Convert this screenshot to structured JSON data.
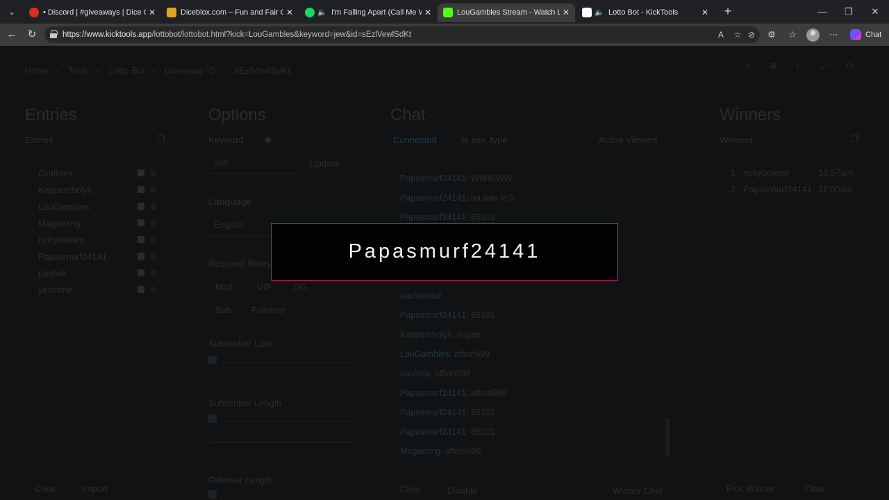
{
  "browser": {
    "tabs": [
      {
        "title": "• Discord | #giveaways | Dice Com",
        "favicon_color": "#d93025",
        "audio": false,
        "active": false
      },
      {
        "title": "Diceblox.com – Fun and Fair Game",
        "favicon_color": "#e0a526",
        "audio": false,
        "active": false
      },
      {
        "title": "I'm Falling Apart (Call Me Whe",
        "favicon_color": "#1ed760",
        "audio": true,
        "active": false
      },
      {
        "title": "LouGambles Stream - Watch Live c",
        "favicon_color": "#53fc18",
        "audio": false,
        "active": true
      },
      {
        "title": "Lotto Bot - KickTools",
        "favicon_color": "#ffffff",
        "audio": true,
        "active": false
      }
    ],
    "url_host": "https://www.kicktools.app",
    "url_path": "/lottobot/lottobot.html?kick=LouGambles&keyword=jew&id=sEzlVewlSdKt",
    "copilot_label": "Chat"
  },
  "page": {
    "breadcrumb": [
      "Home",
      "Tools",
      "Lotto Bot",
      "Giveaway ID",
      "sEzlVewlSdKt"
    ],
    "entries": {
      "title": "Entries",
      "subtitle": "Entries",
      "list": [
        "GrafMes",
        "Kaspercholyk",
        "LouGambles",
        "Magaezng",
        "rickyboasnt",
        "Papasmurf24141",
        "paulvik",
        "yesmme"
      ],
      "clear_label": "Clear",
      "import_label": "Import"
    },
    "options": {
      "title": "Options",
      "keyword_label": "Keyword",
      "keyword_value": "jew",
      "update_label": "Update",
      "language_label": "Language",
      "language_value": "English",
      "required_roles_label": "Required Roles",
      "roles": [
        "Mod",
        "VIP",
        "OG",
        "Sub",
        "Follower"
      ],
      "subscriber_luck_label": "Subscriber Luck",
      "subscriber_length_label": "Subscriber Length",
      "follower_length_label": "Follower Length"
    },
    "chat": {
      "title": "Chat",
      "connected_label": "Connected",
      "to_join_label": "to join, type",
      "active_viewers_label": "Active Viewers",
      "lines": [
        {
          "user": "Papasmurf24141:",
          "msg": "WWWWW"
        },
        {
          "user": "Papasmurf24141:",
          "msg": "ha aan fe fr"
        },
        {
          "user": "Papasmurf24141:",
          "msg": "65101"
        },
        {
          "user": "aacliatolsd",
          "msg": ""
        },
        {
          "user": "Papasmurf24141:",
          "msg": "65101"
        },
        {
          "user": "Kaspercholyk:",
          "msg": "hugee"
        },
        {
          "user": "LouGambles:",
          "msg": "affion999"
        },
        {
          "user": "oaslieta:",
          "msg": "affion999"
        },
        {
          "user": "Papasmurf24141:",
          "msg": "affion999"
        },
        {
          "user": "Papasmurf24141:",
          "msg": "65101"
        },
        {
          "user": "Papasmurf24141:",
          "msg": "65101"
        },
        {
          "user": "Magaezng:",
          "msg": "affion999"
        }
      ],
      "clear_label": "Clear",
      "disable_label": "Disable",
      "winner_chat_label": "Winner Chat"
    },
    "winners": {
      "title": "Winners",
      "subtitle": "Winners",
      "list": [
        {
          "rank": "1.",
          "name": "rickyboasnt",
          "time": "10:57am"
        },
        {
          "rank": "2.",
          "name": "Papasmurf24141",
          "time": "11:00am"
        }
      ],
      "pick_label": "Pick Winner",
      "clear_label": "Clear"
    }
  },
  "modal": {
    "winner_name": "Papasmurf24141",
    "border_color": "#e0187a"
  }
}
